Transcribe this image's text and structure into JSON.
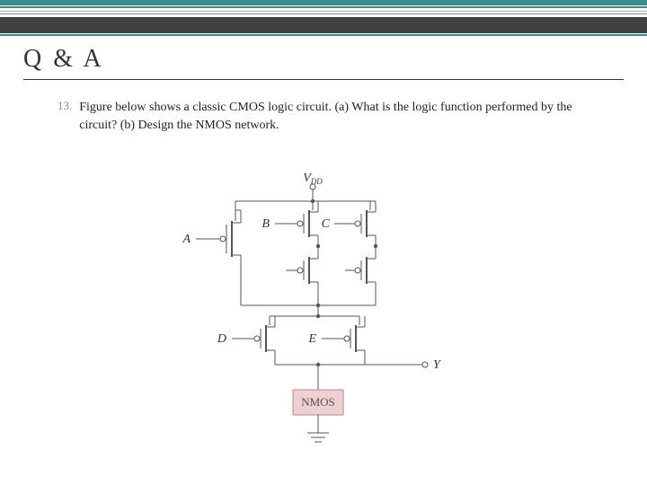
{
  "title": "Q & A",
  "question": {
    "number": "13.",
    "text": "Figure below shows a classic CMOS logic circuit. (a) What is the logic function performed by the circuit? (b) Design the NMOS network."
  },
  "circuit": {
    "supply": "V",
    "supply_sub": "DD",
    "inputs": [
      "A",
      "B",
      "C",
      "D",
      "E"
    ],
    "output": "Y",
    "block": "NMOS"
  }
}
